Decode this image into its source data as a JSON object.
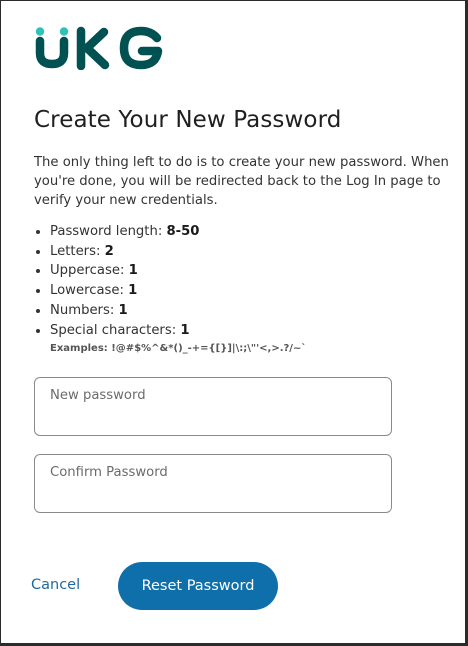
{
  "brand": {
    "logo_text": "UKG",
    "primary_color": "#005151",
    "accent_color": "#30c2b7"
  },
  "page": {
    "title": "Create Your New Password",
    "intro": "The only thing left to do is to create your new password. When you're done, you will be redirected back to the Log In page to verify your new credentials."
  },
  "requirements": [
    {
      "label": "Password length: ",
      "value": "8-50"
    },
    {
      "label": "Letters: ",
      "value": "2"
    },
    {
      "label": "Uppercase: ",
      "value": "1"
    },
    {
      "label": "Lowercase: ",
      "value": "1"
    },
    {
      "label": "Numbers: ",
      "value": "1"
    },
    {
      "label": "Special characters: ",
      "value": "1"
    }
  ],
  "examples": {
    "label": "Examples: ",
    "value": "!@#$%^&*()_-+={[}]|\\:;\\\"'<,>.?/~`"
  },
  "form": {
    "new_password_placeholder": "New password",
    "confirm_password_placeholder": "Confirm Password"
  },
  "actions": {
    "cancel_label": "Cancel",
    "reset_label": "Reset Password",
    "button_color": "#0f6fab",
    "link_color": "#1f6a9e"
  }
}
